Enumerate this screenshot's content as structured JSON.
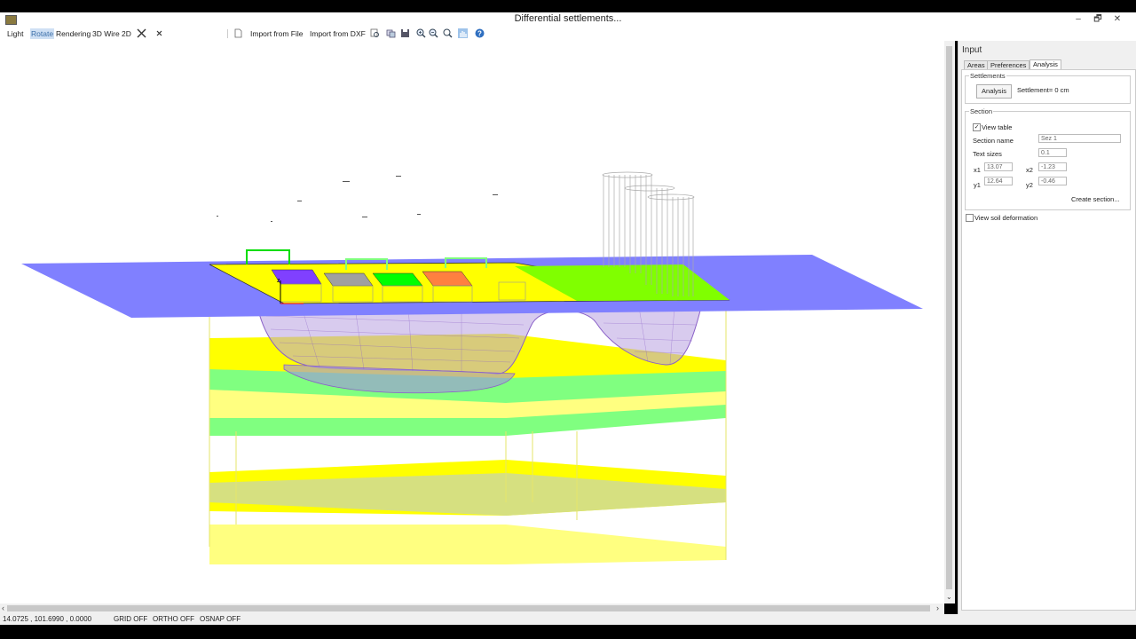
{
  "window": {
    "title": "Differential settlements...",
    "controls": [
      "–",
      "🗗",
      "✕"
    ]
  },
  "toolbar": {
    "light": "Light",
    "rotate": "Rotate",
    "rendering": "Rendering",
    "wire3d": "3D Wire",
    "view2d": "2D",
    "import_file": "Import from File",
    "import_dxf": "Import from DXF"
  },
  "icons": [
    "close-x-icon",
    "close-icon",
    "new-file-icon",
    "zoom-icon",
    "copy-icon",
    "save-icon",
    "zoom-in-icon",
    "zoom-out-icon",
    "zoom-window-icon",
    "pan-hand-icon",
    "help-icon"
  ],
  "panel": {
    "title": "Input",
    "tabs": [
      "Areas",
      "Preferences",
      "Analysis"
    ],
    "selected_tab": "Analysis",
    "settlements": {
      "group_label": "Settlements",
      "analysis_button": "Analysis",
      "result": "Settlement= 0 cm"
    },
    "section": {
      "group_label": "Section",
      "view_table_label": "View table",
      "view_table_checked": true,
      "section_name_label": "Section name",
      "section_name_value": "Sez 1",
      "text_sizes_label": "Text sizes",
      "text_sizes_value": "0.1",
      "x1_label": "x1",
      "x1_value": "13.07",
      "x2_label": "x2",
      "x2_value": "-1.23",
      "y1_label": "y1",
      "y1_value": "12.64",
      "y2_label": "y2",
      "y2_value": "-0.46",
      "create_button": "Create section..."
    },
    "soil_deformation_label": "View soil deformation",
    "soil_deformation_checked": false
  },
  "status": {
    "coords": "14.0725 , 101.6990 , 0.0000",
    "grid": "GRID OFF",
    "ortho": "ORTHO OFF",
    "osnap": "OSNAP OFF"
  },
  "scroll": {
    "left_arrow": "‹",
    "right_arrow": "›",
    "down_arrow": "⌄"
  },
  "colors": {
    "ground_plane": "#8080ff",
    "soil_layer_yellow": "#ffff00",
    "soil_layer_green": "#80ff80",
    "soil_layer_olive": "#d6e080",
    "mesh": "#8a60c8",
    "accent_tab": "#3b6ea8"
  }
}
